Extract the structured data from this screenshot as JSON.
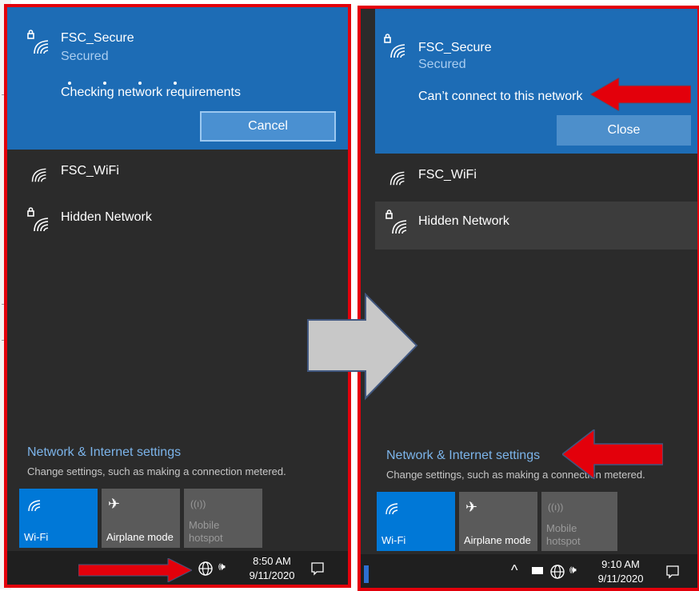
{
  "left": {
    "active_network": {
      "name": "FSC_Secure",
      "security": "Secured",
      "status": "Checking network requirements",
      "button": "Cancel"
    },
    "networks": [
      {
        "name": "FSC_WiFi"
      },
      {
        "name": "Hidden Network"
      }
    ],
    "settings": {
      "link": "Network & Internet settings",
      "description": "Change settings, such as making a connection metered."
    },
    "tiles": [
      {
        "label": "Wi-Fi",
        "state": "on"
      },
      {
        "label": "Airplane mode",
        "state": "off"
      },
      {
        "label": "Mobile hotspot",
        "state": "disabled"
      }
    ],
    "taskbar": {
      "time": "8:50 AM",
      "date": "9/11/2020"
    }
  },
  "right": {
    "active_network": {
      "name": "FSC_Secure",
      "security": "Secured",
      "status": "Can’t connect to this network",
      "button": "Close"
    },
    "networks": [
      {
        "name": "FSC_WiFi"
      },
      {
        "name": "Hidden Network"
      }
    ],
    "settings": {
      "link": "Network & Internet settings",
      "description": "Change settings, such as making a connection metered."
    },
    "tiles": [
      {
        "label": "Wi-Fi",
        "state": "on"
      },
      {
        "label": "Airplane mode",
        "state": "off"
      },
      {
        "label": "Mobile hotspot",
        "state": "disabled"
      }
    ],
    "taskbar": {
      "time": "9:10 AM",
      "date": "9/11/2020"
    }
  },
  "colors": {
    "flyout_bg": "#2b2b2b",
    "active_bg": "#1d6cb5",
    "accent_tile": "#0078d7",
    "annotation_red": "#e3000b",
    "arrow_gray": "#c8c8c8",
    "arrow_outline": "#41577f"
  }
}
